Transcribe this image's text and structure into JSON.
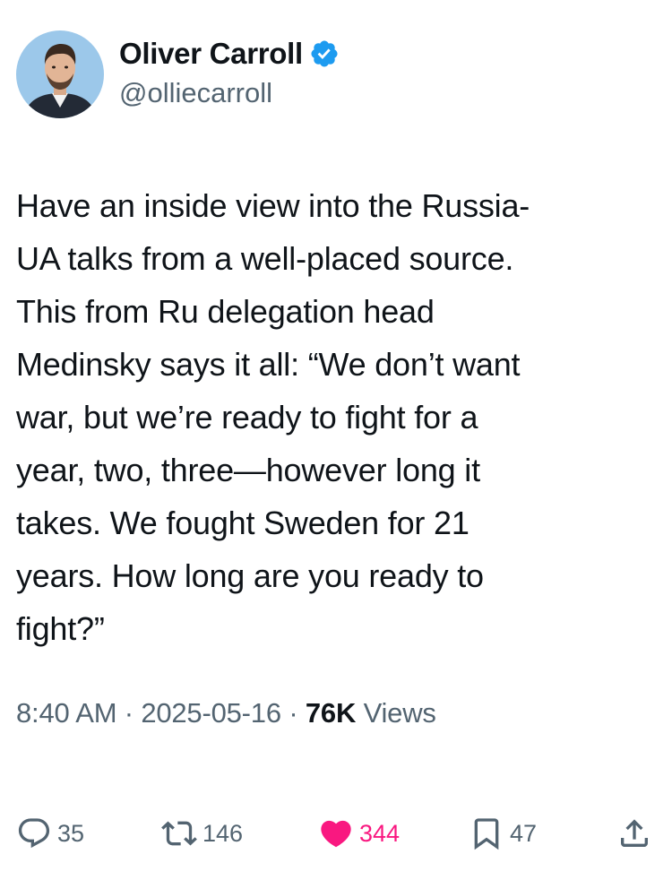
{
  "tweet": {
    "author_name": "Oliver Carroll",
    "handle": "@olliecarroll",
    "verified": true,
    "text_lines": [
      "Have an inside view into the Russia-",
      "UA talks from a well-placed source.",
      "This from Ru delegation head",
      "Medinsky says it all: “We don’t want",
      "war, but we’re ready to fight for a",
      "year, two, three—however long it",
      "takes. We fought Sweden for 21",
      "years. How long are you ready to",
      "fight?”"
    ],
    "time": "8:40 AM",
    "separator": "·",
    "date": "2025-05-16",
    "views_count": "76K",
    "views_label": "Views"
  },
  "actions": {
    "replies": "35",
    "reposts": "146",
    "likes": "344",
    "bookmarks": "47",
    "liked": true
  },
  "icons": {
    "reply": "reply-icon",
    "repost": "repost-icon",
    "like": "heart-icon",
    "bookmark": "bookmark-icon",
    "share": "share-icon",
    "verified": "verified-badge-icon"
  },
  "colors": {
    "text": "#0f1419",
    "secondary": "#536471",
    "verified": "#1d9bf0",
    "like": "#f91880"
  }
}
